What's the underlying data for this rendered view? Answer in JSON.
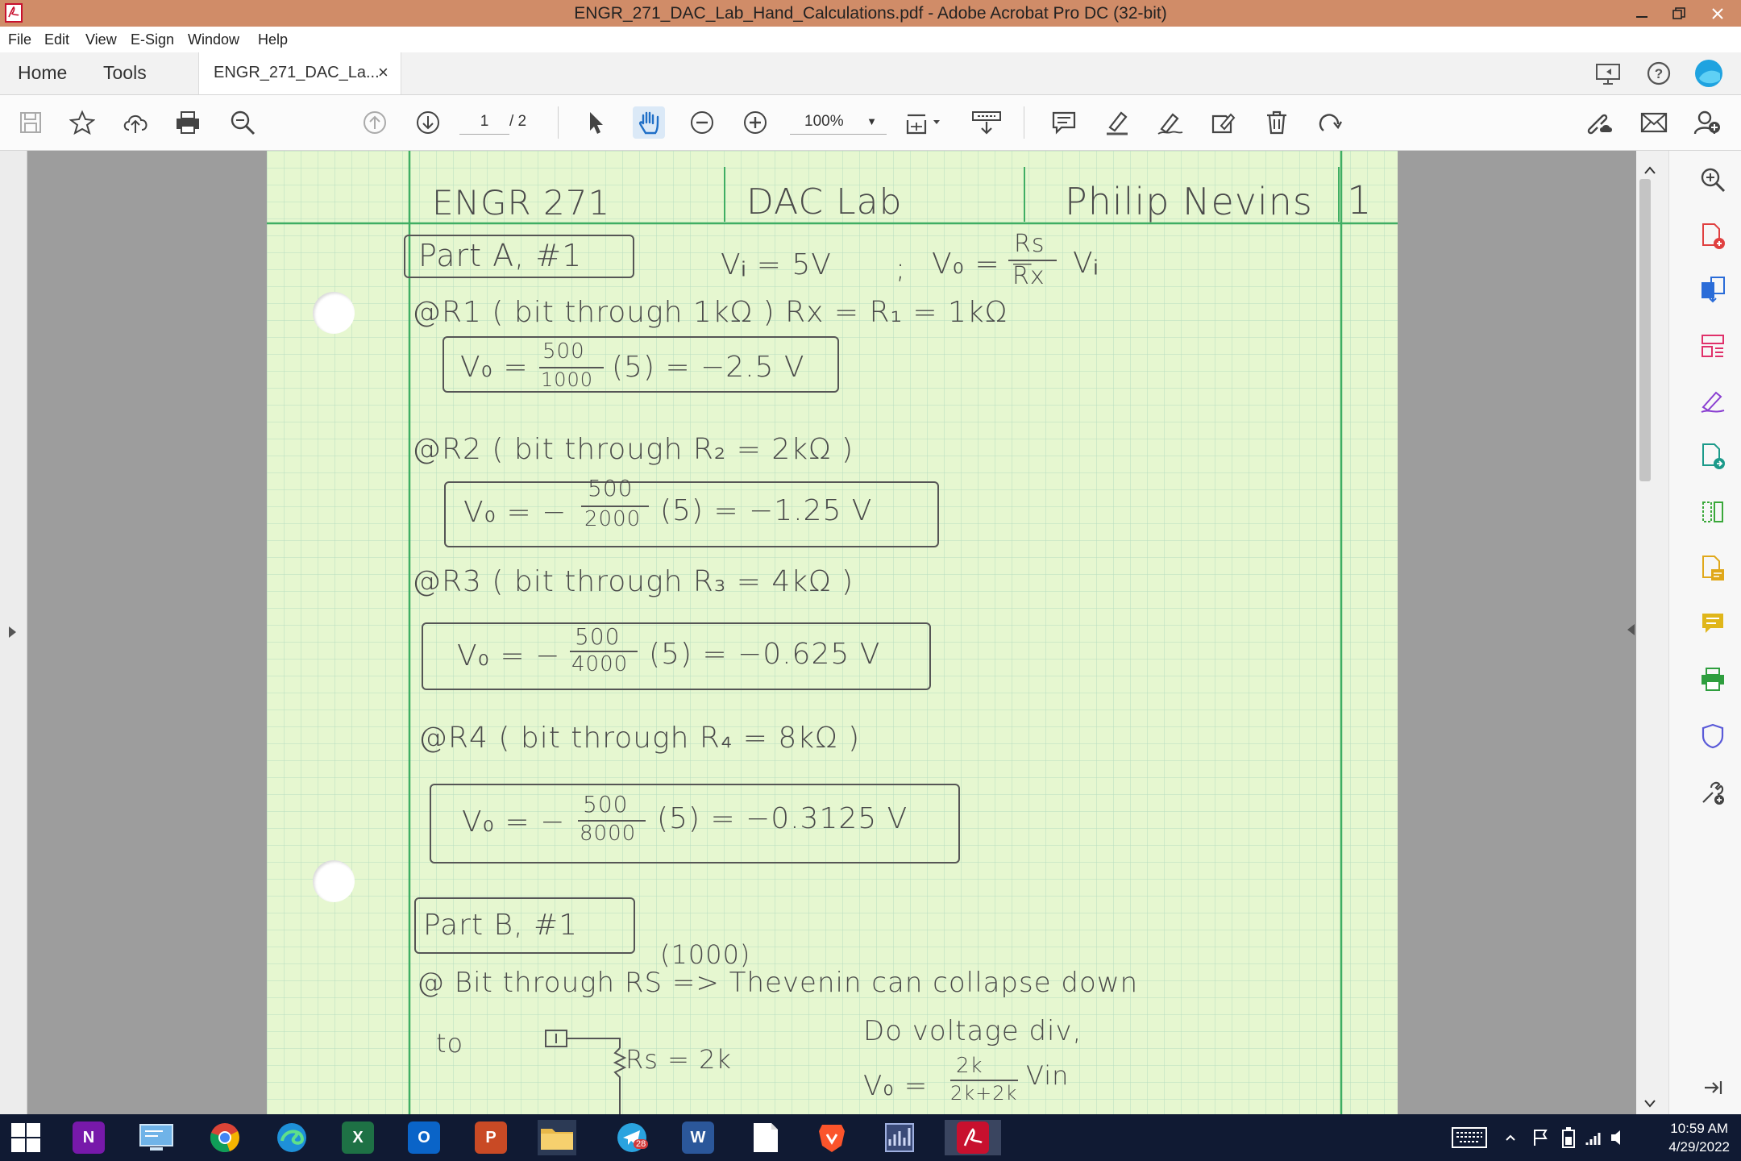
{
  "window": {
    "title": "ENGR_271_DAC_Lab_Hand_Calculations.pdf - Adobe Acrobat Pro DC (32-bit)"
  },
  "menu": [
    "File",
    "Edit",
    "View",
    "E-Sign",
    "Window",
    "Help"
  ],
  "tabs": {
    "home": "Home",
    "tools": "Tools",
    "document": "ENGR_271_DAC_La...",
    "close_glyph": "×"
  },
  "toolbar": {
    "page_current": "1",
    "page_total": "/ 2",
    "zoom": "100%"
  },
  "page": {
    "header": {
      "course": "ENGR 271",
      "lab": "DAC Lab",
      "name": "Philip Nevins",
      "page_no": "1"
    },
    "part_a_label": "Part A, #1",
    "given_vi": "Vᵢ = 5V",
    "given_sep": ";",
    "formula_left": "V₀ = −",
    "formula_num": "Rs",
    "formula_den": "Rx",
    "formula_right": "Vᵢ",
    "r1_line": "@R1 ( bit through 1kΩ )  Rx = R₁ = 1kΩ",
    "r1_lhs": "V₀ = −",
    "r1_num": "500",
    "r1_den": "1000",
    "r1_rhs": "(5) = −2.5 V",
    "r2_line": "@R2 ( bit through R₂ = 2kΩ )",
    "r2_lhs": "V₀ = −",
    "r2_num": "500",
    "r2_den": "2000",
    "r2_rhs": "(5)  =  −1.25 V",
    "r3_line": "@R3 ( bit through R₃ = 4kΩ )",
    "r3_lhs": "V₀ = −",
    "r3_num": "500",
    "r3_den": "4000",
    "r3_rhs": "(5) = −0.625 V",
    "r4_line": "@R4 ( bit through R₄ = 8kΩ )",
    "r4_lhs": "V₀ = −",
    "r4_num": "500",
    "r4_den": "8000",
    "r4_rhs": "(5)  =  −0.3125 V",
    "part_b_label": "Part B, #1",
    "b_value": "(1000)",
    "b_line": "@ Bit through RS  =>   Thevenin can collapse down",
    "b_to": "to",
    "b_rs": "Rs = 2k",
    "b_div": "Do voltage div,",
    "b_vo": "V₀ =",
    "b_num": "2k",
    "b_den": "2k+2k",
    "b_vin": "Vin"
  },
  "taskbar": {
    "time": "10:59 AM",
    "date": "4/29/2022",
    "telegram_badge": "28",
    "apps": [
      "OneNote",
      "Remote Desktop",
      "Chrome",
      "Edge",
      "Excel",
      "Outlook",
      "PowerPoint",
      "File Explorer",
      "Telegram",
      "Word",
      "Notepad",
      "Brave",
      "Task Manager",
      "Acrobat"
    ]
  },
  "colors": {
    "titlebar": "#d08c68",
    "paper": "#e6f7d0",
    "grid": "#b7dcbf",
    "margin_line": "#3fae63",
    "pencil": "#4a4a4a",
    "taskbar": "#101a33",
    "acrobat_red": "#c8102e"
  }
}
